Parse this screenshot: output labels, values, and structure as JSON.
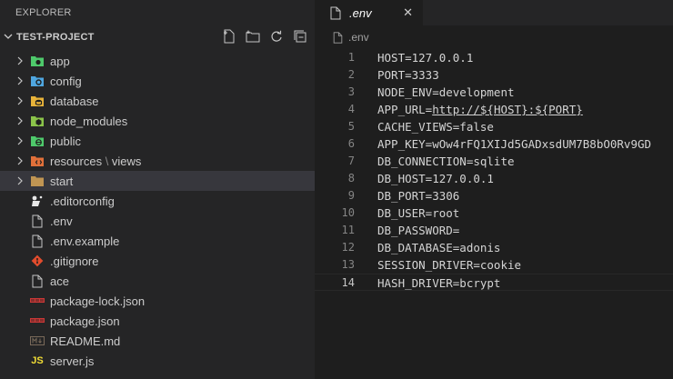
{
  "explorer": {
    "title": "EXPLORER",
    "project": "TEST-PROJECT",
    "actions": [
      "new-file-icon",
      "new-folder-icon",
      "refresh-icon",
      "collapse-all-icon"
    ],
    "items": [
      {
        "label": "app",
        "type": "folder",
        "icon": "app-folder-icon",
        "color": "#4ec96b"
      },
      {
        "label": "config",
        "type": "folder",
        "icon": "config-folder-icon",
        "color": "#4fa6e0"
      },
      {
        "label": "database",
        "type": "folder",
        "icon": "database-folder-icon",
        "color": "#e8b33a"
      },
      {
        "label": "node_modules",
        "type": "folder",
        "icon": "node-modules-folder-icon",
        "color": "#8bc34a"
      },
      {
        "label": "public",
        "type": "folder",
        "icon": "public-folder-icon",
        "color": "#4ec96b"
      },
      {
        "label_main": "resources",
        "label_sep": " \\ ",
        "label_tail": "views",
        "type": "folder",
        "icon": "resources-folder-icon",
        "color": "#e0703a"
      },
      {
        "label": "start",
        "type": "folder",
        "icon": "folder-icon",
        "color": "#c09553"
      },
      {
        "label": ".editorconfig",
        "type": "file",
        "icon": "editorconfig-icon"
      },
      {
        "label": ".env",
        "type": "file",
        "icon": "file-icon"
      },
      {
        "label": ".env.example",
        "type": "file",
        "icon": "file-icon"
      },
      {
        "label": ".gitignore",
        "type": "file",
        "icon": "git-icon",
        "color": "#e24c2d"
      },
      {
        "label": "ace",
        "type": "file",
        "icon": "file-icon"
      },
      {
        "label": "package-lock.json",
        "type": "file",
        "icon": "npm-icon",
        "color": "#cb3837"
      },
      {
        "label": "package.json",
        "type": "file",
        "icon": "npm-icon",
        "color": "#cb3837"
      },
      {
        "label": "README.md",
        "type": "file",
        "icon": "markdown-icon"
      },
      {
        "label": "server.js",
        "type": "file",
        "icon": "javascript-icon",
        "color": "#f1dd35"
      }
    ]
  },
  "editor": {
    "tab": {
      "label": ".env",
      "close": "✕"
    },
    "breadcrumb": ".env",
    "lines": [
      {
        "n": "1",
        "text": "HOST=127.0.0.1"
      },
      {
        "n": "2",
        "text": "PORT=3333"
      },
      {
        "n": "3",
        "text": "NODE_ENV=development"
      },
      {
        "n": "4",
        "pre": "APP_URL=",
        "link": "http://${HOST}:${PORT}"
      },
      {
        "n": "5",
        "text": "CACHE_VIEWS=false"
      },
      {
        "n": "6",
        "text": "APP_KEY=wOw4rFQ1XIJd5GADxsdUM7B8bO0Rv9GD"
      },
      {
        "n": "7",
        "text": "DB_CONNECTION=sqlite"
      },
      {
        "n": "8",
        "text": "DB_HOST=127.0.0.1"
      },
      {
        "n": "9",
        "text": "DB_PORT=3306"
      },
      {
        "n": "10",
        "text": "DB_USER=root"
      },
      {
        "n": "11",
        "text": "DB_PASSWORD="
      },
      {
        "n": "12",
        "text": "DB_DATABASE=adonis"
      },
      {
        "n": "13",
        "text": "SESSION_DRIVER=cookie"
      },
      {
        "n": "14",
        "text": "HASH_DRIVER=bcrypt"
      }
    ]
  }
}
